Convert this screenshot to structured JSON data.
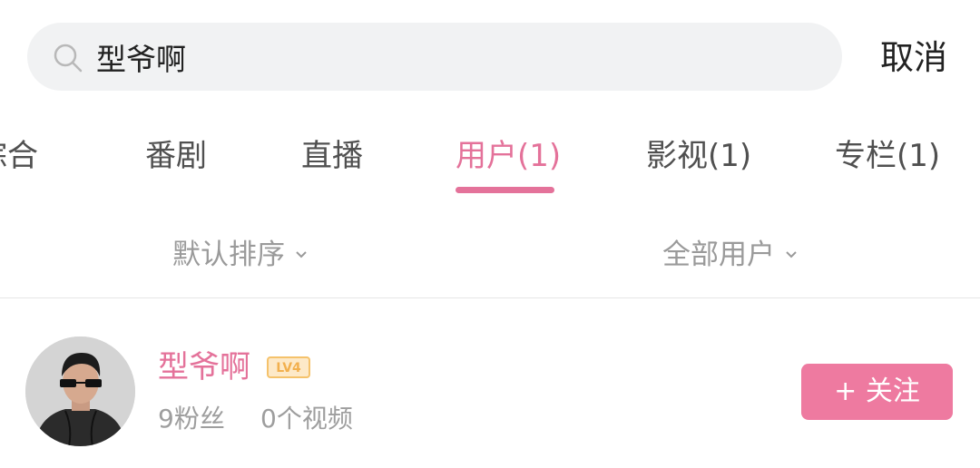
{
  "search": {
    "value": "型爷啊",
    "cancel_label": "取消"
  },
  "tabs": [
    {
      "label": "综合",
      "active": false
    },
    {
      "label": "番剧",
      "active": false
    },
    {
      "label": "直播",
      "active": false
    },
    {
      "label": "用户(1)",
      "active": true
    },
    {
      "label": "影视(1)",
      "active": false
    },
    {
      "label": "专栏(1)",
      "active": false
    }
  ],
  "filters": {
    "sort_label": "默认排序",
    "user_type_label": "全部用户"
  },
  "user": {
    "name": "型爷啊",
    "level": "LV4",
    "followers": "9粉丝",
    "videos": "0个视频",
    "follow_label": "+ 关注"
  },
  "colors": {
    "accent": "#e4729a",
    "follow_button": "#ee7aa0",
    "level_badge": "#f5c26b"
  }
}
